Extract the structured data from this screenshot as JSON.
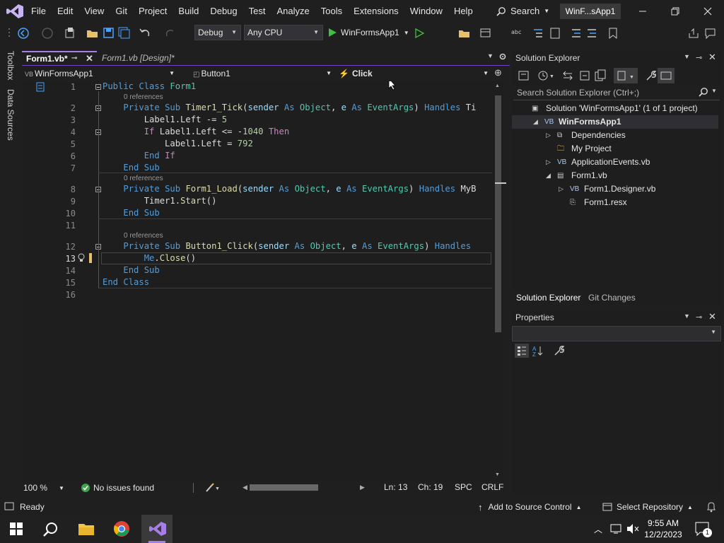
{
  "menu": {
    "items": [
      "File",
      "Edit",
      "View",
      "Git",
      "Project",
      "Build",
      "Debug",
      "Test",
      "Analyze",
      "Tools",
      "Extensions",
      "Window",
      "Help"
    ],
    "search_label": "Search",
    "solution_badge": "WinF...sApp1"
  },
  "toolbar": {
    "config": "Debug",
    "platform": "Any CPU",
    "start_target": "WinFormsApp1"
  },
  "left_strip": {
    "toolbox": "Toolbox",
    "data_sources": "Data Sources"
  },
  "tabs": {
    "active": "Form1.vb*",
    "designer": "Form1.vb [Design]*"
  },
  "nav": {
    "project": "WinFormsApp1",
    "object": "Button1",
    "event": "Click"
  },
  "editor": {
    "lines": [
      {
        "n": "1",
        "lens": null
      },
      {
        "n": "2",
        "lens": "0 references"
      },
      {
        "n": "3",
        "lens": null
      },
      {
        "n": "4",
        "lens": null
      },
      {
        "n": "5",
        "lens": null
      },
      {
        "n": "6",
        "lens": null
      },
      {
        "n": "7",
        "lens": null
      },
      {
        "n": "8",
        "lens": "0 references"
      },
      {
        "n": "9",
        "lens": null
      },
      {
        "n": "10",
        "lens": null
      },
      {
        "n": "11",
        "lens": null
      },
      {
        "n": "12",
        "lens": "0 references"
      },
      {
        "n": "13",
        "lens": null
      },
      {
        "n": "14",
        "lens": null
      },
      {
        "n": "15",
        "lens": null
      },
      {
        "n": "16",
        "lens": null
      }
    ],
    "code": [
      "Public Class Form1",
      "    Private Sub Timer1_Tick(sender As Object, e As EventArgs) Handles Ti",
      "        Label1.Left -= 5",
      "        If Label1.Left <= -1040 Then",
      "            Label1.Left = 792",
      "        End If",
      "    End Sub",
      "    Private Sub Form1_Load(sender As Object, e As EventArgs) Handles MyB",
      "        Timer1.Start()",
      "    End Sub",
      "",
      "    Private Sub Button1_Click(sender As Object, e As EventArgs) Handles",
      "        Me.Close()",
      "    End Sub",
      "End Class",
      ""
    ]
  },
  "editor_status": {
    "zoom": "100 %",
    "issues": "No issues found",
    "line": "Ln: 13",
    "col": "Ch: 19",
    "spacing": "SPC",
    "eol": "CRLF"
  },
  "solution_explorer": {
    "title": "Solution Explorer",
    "search_placeholder": "Search Solution Explorer (Ctrl+;)",
    "tree": [
      {
        "label": "Solution 'WinFormsApp1' (1 of 1 project)",
        "icon": "solution-icon",
        "depth": 0,
        "expander": ""
      },
      {
        "label": "WinFormsApp1",
        "icon": "vb-project-icon",
        "depth": 1,
        "expander": "expanded",
        "selected": true
      },
      {
        "label": "Dependencies",
        "icon": "dependencies-icon",
        "depth": 2,
        "expander": "collapsed"
      },
      {
        "label": "My Project",
        "icon": "wrench-folder-icon",
        "depth": 2,
        "expander": ""
      },
      {
        "label": "ApplicationEvents.vb",
        "icon": "vb-file-icon",
        "depth": 2,
        "expander": "collapsed"
      },
      {
        "label": "Form1.vb",
        "icon": "form-icon",
        "depth": 2,
        "expander": "expanded"
      },
      {
        "label": "Form1.Designer.vb",
        "icon": "vb-file-icon",
        "depth": 3,
        "expander": "collapsed"
      },
      {
        "label": "Form1.resx",
        "icon": "resx-icon",
        "depth": 3,
        "expander": ""
      }
    ],
    "tab_solution": "Solution Explorer",
    "tab_git": "Git Changes"
  },
  "properties": {
    "title": "Properties"
  },
  "statusbar": {
    "ready": "Ready",
    "source_control": "Add to Source Control",
    "repository": "Select Repository"
  },
  "taskbar": {
    "time": "9:55 AM",
    "date": "12/2/2023",
    "notification_count": "1"
  },
  "colors": {
    "accent": "#a67ee6",
    "keyword": "#569cd6",
    "type": "#4ec9b0",
    "method": "#dcdcaa",
    "control": "#c586c0"
  }
}
